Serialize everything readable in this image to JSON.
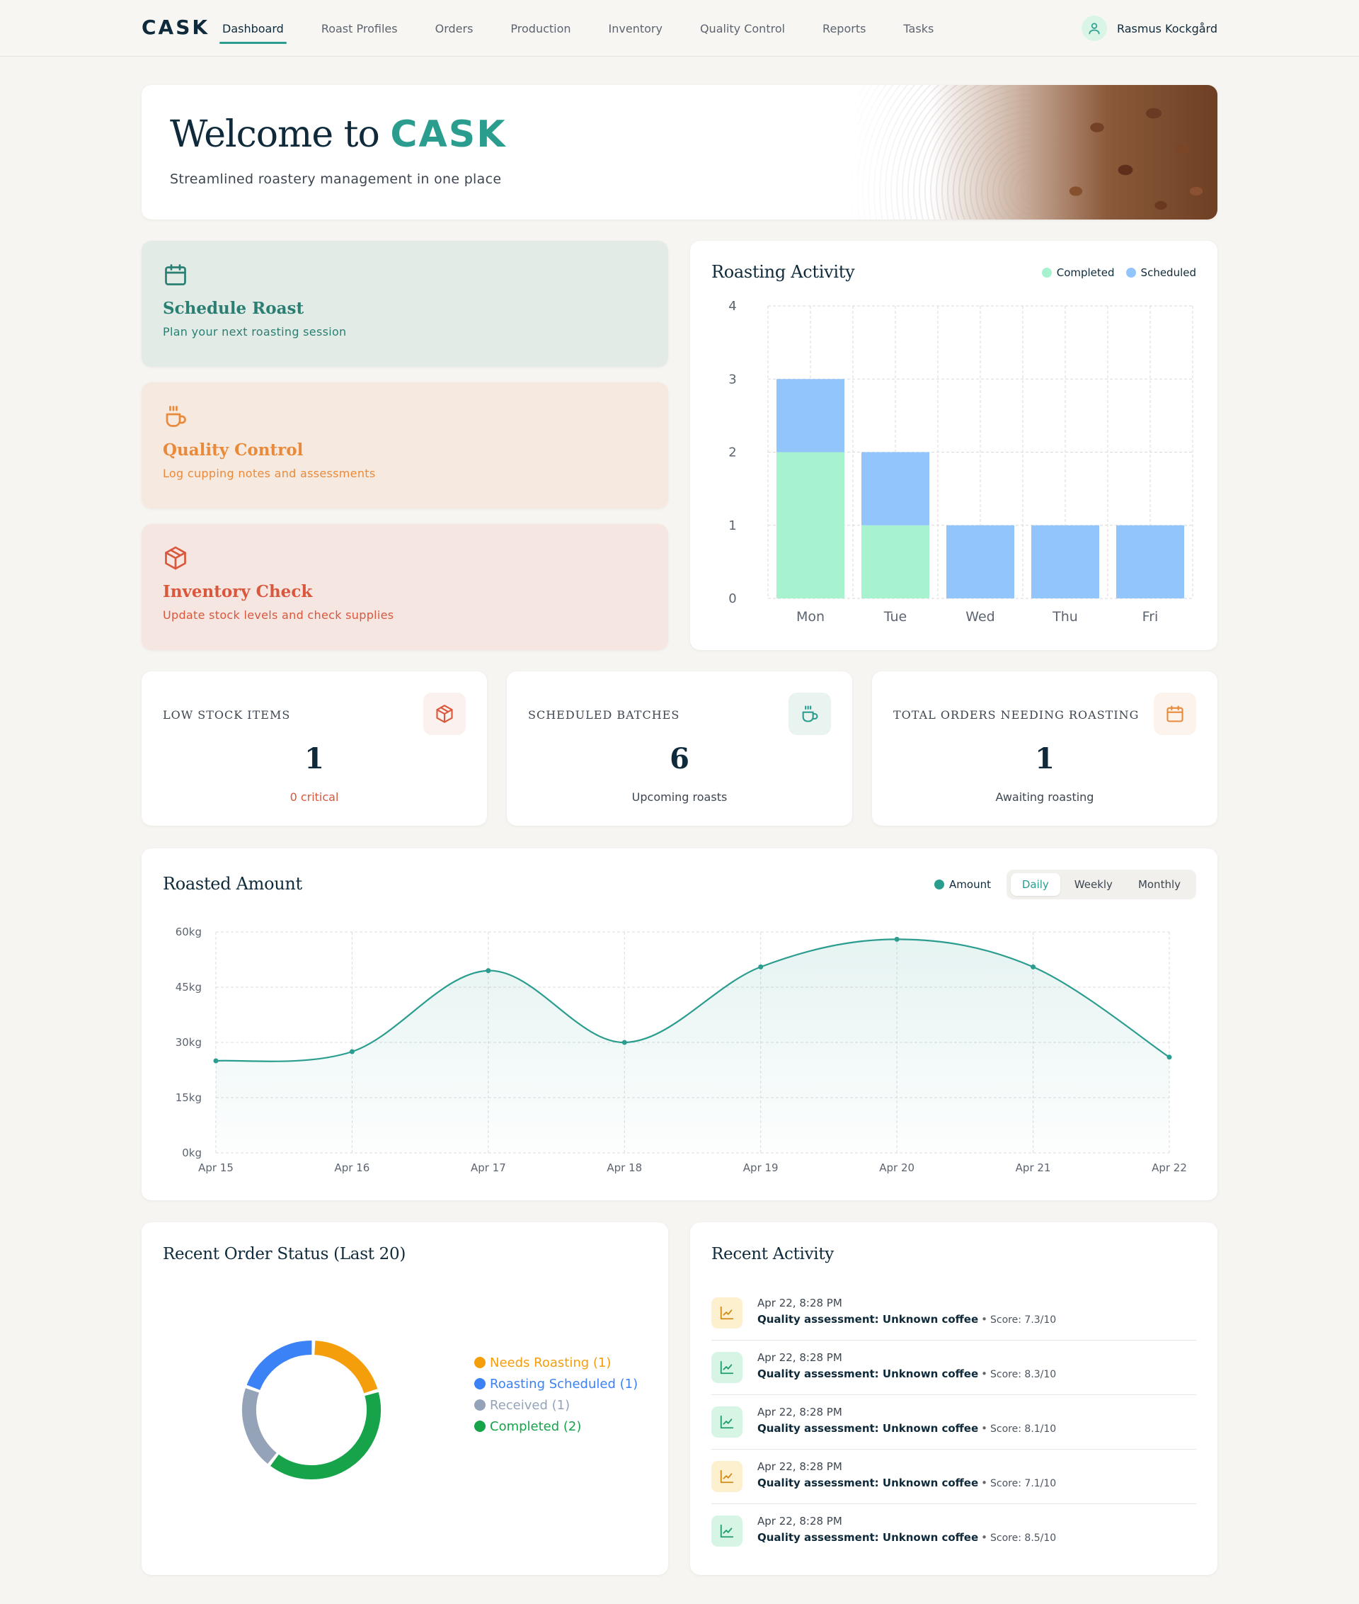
{
  "nav": {
    "brand": "CASK",
    "items": [
      "Dashboard",
      "Roast Profiles",
      "Orders",
      "Production",
      "Inventory",
      "Quality Control",
      "Reports",
      "Tasks"
    ],
    "active": "Dashboard",
    "user_name": "Rasmus Kockgård"
  },
  "hero": {
    "title_prefix": "Welcome to",
    "title_brand": "CASK",
    "subtitle": "Streamlined roastery management in one place"
  },
  "actions": [
    {
      "title": "Schedule Roast",
      "subtitle": "Plan your next roasting session",
      "icon": "calendar-icon"
    },
    {
      "title": "Quality Control",
      "subtitle": "Log cupping notes and assessments",
      "icon": "coffee-cup-icon"
    },
    {
      "title": "Inventory Check",
      "subtitle": "Update stock levels and check supplies",
      "icon": "box-icon"
    }
  ],
  "roasting_activity": {
    "title": "Roasting Activity",
    "legend": {
      "completed": "Completed",
      "scheduled": "Scheduled"
    }
  },
  "stats": [
    {
      "label": "LOW STOCK ITEMS",
      "value": "1",
      "sub": "0 critical",
      "icon": "box-icon"
    },
    {
      "label": "SCHEDULED BATCHES",
      "value": "6",
      "sub": "Upcoming roasts",
      "icon": "coffee-cup-icon"
    },
    {
      "label": "TOTAL ORDERS NEEDING ROASTING",
      "value": "1",
      "sub": "Awaiting roasting",
      "icon": "calendar-icon"
    }
  ],
  "roasted_amount": {
    "title": "Roasted Amount",
    "legend": "Amount",
    "periods": [
      "Daily",
      "Weekly",
      "Monthly"
    ],
    "active_period": "Daily"
  },
  "order_status": {
    "title": "Recent Order Status (Last 20)",
    "legend": [
      "Needs Roasting (1)",
      "Roasting Scheduled (1)",
      "Received (1)",
      "Completed (2)"
    ]
  },
  "recent_activity": {
    "title": "Recent Activity",
    "items": [
      {
        "time": "Apr 22, 8:28 PM",
        "text": "Quality assessment: Unknown coffee",
        "sep": "•",
        "score": "Score: 7.3/10",
        "tone": "amber"
      },
      {
        "time": "Apr 22, 8:28 PM",
        "text": "Quality assessment: Unknown coffee",
        "sep": "•",
        "score": "Score: 8.3/10",
        "tone": "green"
      },
      {
        "time": "Apr 22, 8:28 PM",
        "text": "Quality assessment: Unknown coffee",
        "sep": "•",
        "score": "Score: 8.1/10",
        "tone": "green"
      },
      {
        "time": "Apr 22, 8:28 PM",
        "text": "Quality assessment: Unknown coffee",
        "sep": "•",
        "score": "Score: 7.1/10",
        "tone": "amber"
      },
      {
        "time": "Apr 22, 8:28 PM",
        "text": "Quality assessment: Unknown coffee",
        "sep": "•",
        "score": "Score: 8.5/10",
        "tone": "green"
      }
    ]
  },
  "colors": {
    "accent": "#2a9d8f",
    "completed": "#a7f3d0",
    "scheduled": "#93c5fd",
    "needs_roasting": "#f59e0b",
    "roasting_scheduled": "#3b82f6",
    "received": "#94a3b8",
    "order_completed": "#16a34a"
  },
  "chart_data": [
    {
      "type": "bar",
      "stacked": true,
      "categories": [
        "Mon",
        "Tue",
        "Wed",
        "Thu",
        "Fri"
      ],
      "series": [
        {
          "name": "Completed",
          "values": [
            2,
            1,
            0,
            0,
            0
          ]
        },
        {
          "name": "Scheduled",
          "values": [
            1,
            1,
            1,
            1,
            1
          ]
        }
      ],
      "ylim": [
        0,
        4
      ],
      "yticks": [
        0,
        1,
        2,
        3,
        4
      ],
      "grid": true,
      "legend": "top-right"
    },
    {
      "type": "area",
      "x": [
        "Apr 15",
        "Apr 16",
        "Apr 17",
        "Apr 18",
        "Apr 19",
        "Apr 20",
        "Apr 21",
        "Apr 22"
      ],
      "series": [
        {
          "name": "Amount",
          "values": [
            25,
            27.5,
            49.5,
            30,
            50.5,
            58,
            50.5,
            26
          ]
        }
      ],
      "ylim": [
        0,
        60
      ],
      "yticks": [
        "0kg",
        "15kg",
        "30kg",
        "45kg",
        "60kg"
      ],
      "ytick_values": [
        0,
        15,
        30,
        45,
        60
      ],
      "grid": true,
      "legend": "top-right"
    },
    {
      "type": "pie",
      "donut": true,
      "categories": [
        "Needs Roasting",
        "Roasting Scheduled",
        "Received",
        "Completed"
      ],
      "values": [
        1,
        1,
        1,
        2
      ],
      "legend": "right"
    }
  ]
}
